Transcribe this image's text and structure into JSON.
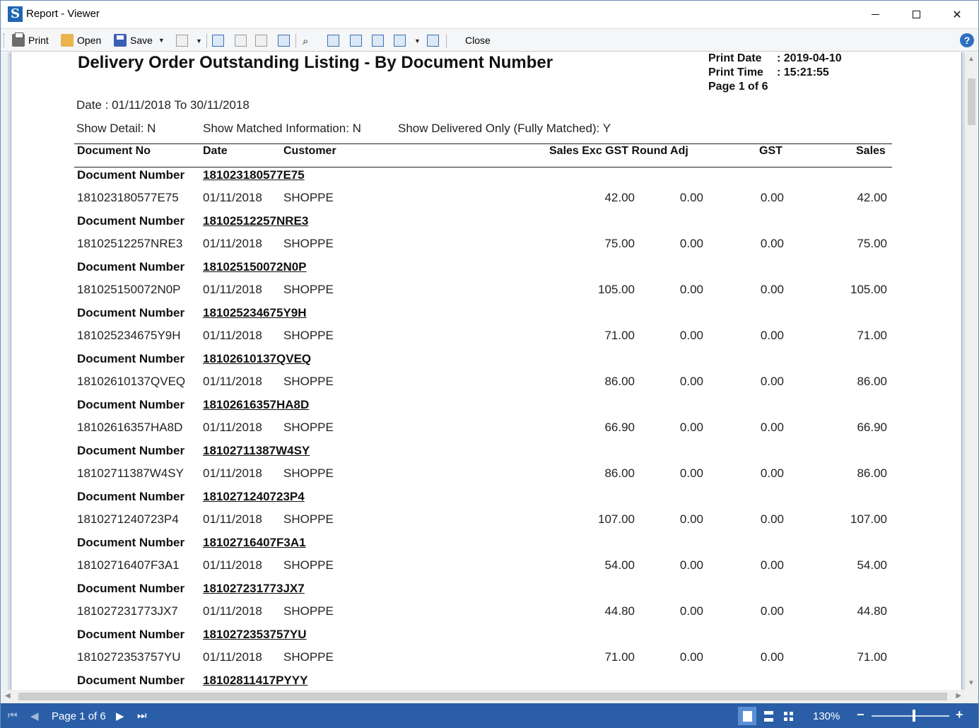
{
  "window": {
    "title": "Report - Viewer"
  },
  "toolbar": {
    "print": "Print",
    "open": "Open",
    "save": "Save",
    "close": "Close",
    "help": "?"
  },
  "report": {
    "title": "Delivery Order Outstanding Listing - By Document Number",
    "print_date_label": "Print Date",
    "print_date": ": 2019-04-10",
    "print_time_label": "Print Time",
    "print_time": ": 15:21:55",
    "page_info": "Page 1 of 6",
    "date_range": "Date : 01/11/2018 To 30/11/2018",
    "filter_detail": "Show Detail: N",
    "filter_matched": "Show Matched Information: N",
    "filter_delivered": "Show Delivered Only (Fully Matched): Y",
    "headers": {
      "doc_no": "Document No",
      "date": "Date",
      "customer": "Customer",
      "sales_exc": "Sales Exc GST Round Adj",
      "gst": "GST",
      "sales": "Sales"
    },
    "group_label": "Document Number",
    "groups": [
      {
        "doc": "181023180577E75",
        "date": "01/11/2018",
        "customer": "SHOPPE",
        "sales_exc": "42.00",
        "round_adj": "0.00",
        "gst": "0.00",
        "sales": "42.00"
      },
      {
        "doc": "18102512257NRE3",
        "date": "01/11/2018",
        "customer": "SHOPPE",
        "sales_exc": "75.00",
        "round_adj": "0.00",
        "gst": "0.00",
        "sales": "75.00"
      },
      {
        "doc": "181025150072N0P",
        "date": "01/11/2018",
        "customer": "SHOPPE",
        "sales_exc": "105.00",
        "round_adj": "0.00",
        "gst": "0.00",
        "sales": "105.00"
      },
      {
        "doc": "181025234675Y9H",
        "date": "01/11/2018",
        "customer": "SHOPPE",
        "sales_exc": "71.00",
        "round_adj": "0.00",
        "gst": "0.00",
        "sales": "71.00"
      },
      {
        "doc": "18102610137QVEQ",
        "date": "01/11/2018",
        "customer": "SHOPPE",
        "sales_exc": "86.00",
        "round_adj": "0.00",
        "gst": "0.00",
        "sales": "86.00"
      },
      {
        "doc": "18102616357HA8D",
        "date": "01/11/2018",
        "customer": "SHOPPE",
        "sales_exc": "66.90",
        "round_adj": "0.00",
        "gst": "0.00",
        "sales": "66.90"
      },
      {
        "doc": "18102711387W4SY",
        "date": "01/11/2018",
        "customer": "SHOPPE",
        "sales_exc": "86.00",
        "round_adj": "0.00",
        "gst": "0.00",
        "sales": "86.00"
      },
      {
        "doc": "1810271240723P4",
        "date": "01/11/2018",
        "customer": "SHOPPE",
        "sales_exc": "107.00",
        "round_adj": "0.00",
        "gst": "0.00",
        "sales": "107.00"
      },
      {
        "doc": "18102716407F3A1",
        "date": "01/11/2018",
        "customer": "SHOPPE",
        "sales_exc": "54.00",
        "round_adj": "0.00",
        "gst": "0.00",
        "sales": "54.00"
      },
      {
        "doc": "181027231773JX7",
        "date": "01/11/2018",
        "customer": "SHOPPE",
        "sales_exc": "44.80",
        "round_adj": "0.00",
        "gst": "0.00",
        "sales": "44.80"
      },
      {
        "doc": "1810272353757YU",
        "date": "01/11/2018",
        "customer": "SHOPPE",
        "sales_exc": "71.00",
        "round_adj": "0.00",
        "gst": "0.00",
        "sales": "71.00"
      }
    ],
    "last_group_doc": "18102811417PYYY"
  },
  "statusbar": {
    "page": "Page 1 of 6",
    "zoom": "130%",
    "zoom_level_percent": 130
  }
}
